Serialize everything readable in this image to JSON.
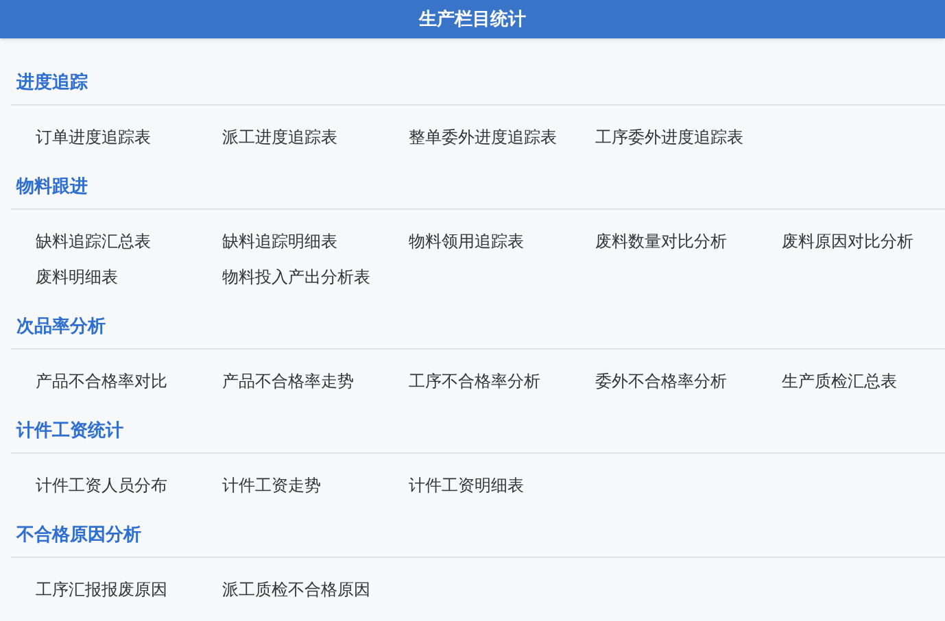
{
  "window": {
    "title": "生产栏目统计"
  },
  "sections": [
    {
      "title": "进度追踪",
      "items": [
        "订单进度追踪表",
        "派工进度追踪表",
        "整单委外进度追踪表",
        "工序委外进度追踪表"
      ]
    },
    {
      "title": "物料跟进",
      "items": [
        "缺料追踪汇总表",
        "缺料追踪明细表",
        "物料领用追踪表",
        "废料数量对比分析",
        "废料原因对比分析",
        "废料明细表",
        "物料投入产出分析表"
      ]
    },
    {
      "title": "次品率分析",
      "items": [
        "产品不合格率对比",
        "产品不合格率走势",
        "工序不合格率分析",
        "委外不合格率分析",
        "生产质检汇总表"
      ]
    },
    {
      "title": "计件工资统计",
      "items": [
        "计件工资人员分布",
        "计件工资走势",
        "计件工资明细表"
      ]
    },
    {
      "title": "不合格原因分析",
      "items": [
        "工序汇报报废原因",
        "派工质检不合格原因"
      ]
    }
  ]
}
